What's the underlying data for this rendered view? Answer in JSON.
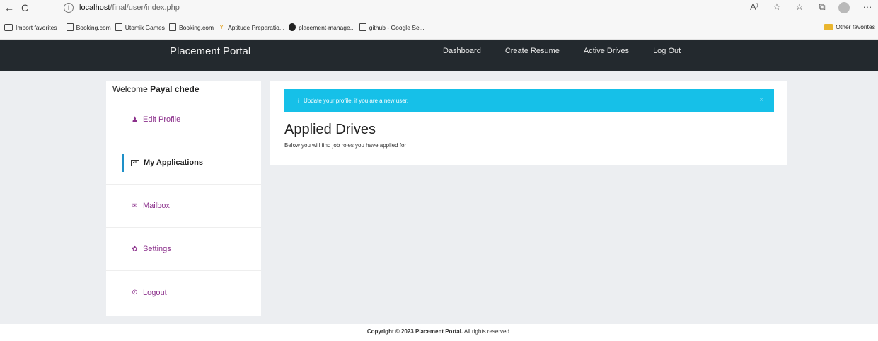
{
  "browser": {
    "back_icon": "←",
    "refresh_icon": "C",
    "info_icon": "i",
    "url_host": "localhost",
    "url_path": "/final/user/index.php",
    "icons": [
      "read-aloud-icon",
      "favorite-add-icon",
      "favorites-icon",
      "collections-icon",
      "profile-icon",
      "more-icon"
    ],
    "icon_glyphs": {
      "read": "A⁾",
      "fav_add": "☆",
      "favs": "☆",
      "coll": "⧉",
      "more": "···"
    }
  },
  "bookmarks": {
    "items": [
      "Import favorites",
      "Booking.com",
      "Utomik Games",
      "Booking.com",
      "Aptitude Preparatio...",
      "placement-manage...",
      "github - Google Se..."
    ],
    "other": "Other favorites"
  },
  "navbar": {
    "brand": "Placement Portal",
    "links": [
      "Dashboard",
      "Create Resume",
      "Active Drives",
      "Log Out"
    ]
  },
  "sidebar": {
    "welcome_prefix": "Welcome ",
    "user_name": "Payal chede",
    "items": [
      {
        "label": "Edit Profile",
        "icon": "user-icon",
        "glyph": "♟"
      },
      {
        "label": "My Applications",
        "icon": "id-card-icon",
        "glyph": "▣≡"
      },
      {
        "label": "Mailbox",
        "icon": "envelope-icon",
        "glyph": "✉"
      },
      {
        "label": "Settings",
        "icon": "gear-icon",
        "glyph": "✿"
      },
      {
        "label": "Logout",
        "icon": "logout-icon",
        "glyph": "⊙"
      }
    ]
  },
  "main": {
    "alert_icon": "i",
    "alert_text": "Update your profile, if you are a new user.",
    "alert_close": "×",
    "heading": "Applied Drives",
    "subtext": "Below you will find job roles you have applied for"
  },
  "footer": {
    "prefix": "Copyright © 2023 Placement Portal.",
    "suffix": " All rights reserved."
  },
  "colors": {
    "navbar_bg": "#23292e",
    "alert_bg": "#16c0e8",
    "sidebar_link": "#8b2f8b",
    "active_marker": "#1e90c8",
    "page_bg": "#eceef1"
  }
}
